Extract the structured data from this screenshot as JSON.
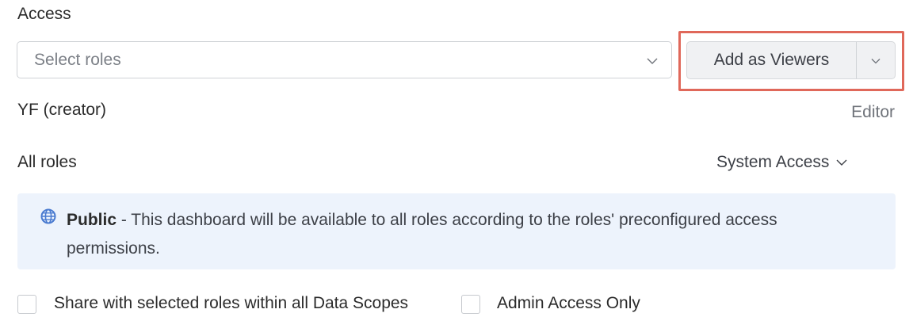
{
  "access": {
    "label": "Access",
    "select_placeholder": "Select roles",
    "add_button_label": "Add as Viewers"
  },
  "creator": {
    "name": "YF (creator)",
    "role": "Editor"
  },
  "all_roles": {
    "label": "All roles",
    "access_dropdown_label": "System Access"
  },
  "banner": {
    "icon": "globe-icon",
    "title": "Public",
    "text": " - This dashboard will be available to all roles according to the roles' preconfigured access permissions."
  },
  "options": {
    "share_data_scopes_label": "Share with selected roles within all Data Scopes",
    "admin_only_label": "Admin Access Only"
  },
  "colors": {
    "highlight": "#e0685a",
    "banner_bg": "#edf3fc",
    "globe": "#4a7bd0"
  }
}
